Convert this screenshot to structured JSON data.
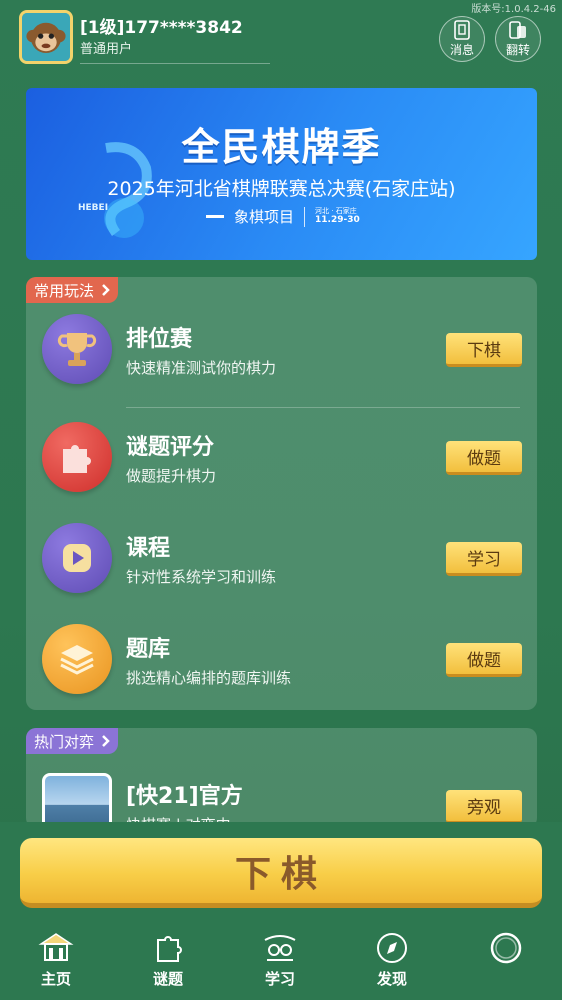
{
  "version": "版本号:1.0.4.2-46",
  "user": {
    "name": "[1级]177****3842",
    "role": "普通用户"
  },
  "header_buttons": [
    {
      "label": "消息",
      "icon": "message-icon"
    },
    {
      "label": "翻转",
      "icon": "flip-icon"
    }
  ],
  "banner": {
    "title": "全民棋牌季",
    "subtitle": "2025年河北省棋牌联赛总决赛(石家庄站)",
    "tag": "象棋项目",
    "location": "河北 · 石家庄",
    "dates": "11.29-30",
    "deco_text": "HEBEI"
  },
  "common": {
    "label": "常用玩法",
    "items": [
      {
        "title": "排位赛",
        "desc": "快速精准测试你的棋力",
        "button": "下棋",
        "icon": "trophy-icon"
      },
      {
        "title": "谜题评分",
        "desc": "做题提升棋力",
        "button": "做题",
        "icon": "puzzle-icon"
      },
      {
        "title": "课程",
        "desc": "针对性系统学习和训练",
        "button": "学习",
        "icon": "play-icon"
      },
      {
        "title": "题库",
        "desc": "挑选精心编排的题库训练",
        "button": "做题",
        "icon": "layers-icon"
      }
    ]
  },
  "hot": {
    "label": "热门对弈",
    "item": {
      "title": "[快21]官方",
      "desc": "快棋赛 | 对弈中",
      "button": "旁观"
    }
  },
  "play_button": "下棋",
  "tabs": [
    {
      "label": "主页",
      "icon": "home-icon"
    },
    {
      "label": "谜题",
      "icon": "puzzle-tab-icon"
    },
    {
      "label": "学习",
      "icon": "study-icon"
    },
    {
      "label": "发现",
      "icon": "compass-icon"
    },
    {
      "label": "",
      "icon": "profile-ring-icon"
    }
  ]
}
